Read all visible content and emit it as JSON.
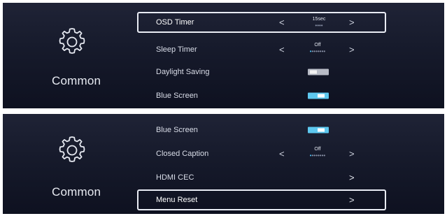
{
  "panels": [
    {
      "category": {
        "label": "Common",
        "icon": "gear-icon"
      },
      "rows": [
        {
          "label": "OSD Timer",
          "type": "selector",
          "value": "15sec",
          "selected": true,
          "dots_total": 4,
          "dots_active": 0
        },
        {
          "label": "Sleep Timer",
          "type": "selector",
          "value": "Off",
          "selected": false,
          "dots_total": 8,
          "dots_active": 1
        },
        {
          "label": "Daylight Saving",
          "type": "toggle",
          "state": "off",
          "selected": false
        },
        {
          "label": "Blue Screen",
          "type": "toggle",
          "state": "on",
          "selected": false
        }
      ]
    },
    {
      "category": {
        "label": "Common",
        "icon": "gear-icon"
      },
      "rows": [
        {
          "label": "Blue Screen",
          "type": "toggle",
          "state": "on",
          "selected": false
        },
        {
          "label": "Closed Caption",
          "type": "selector",
          "value": "Off",
          "selected": false,
          "dots_total": 8,
          "dots_active": 1
        },
        {
          "label": "HDMI CEC",
          "type": "submenu",
          "selected": false
        },
        {
          "label": "Menu Reset",
          "type": "submenu",
          "selected": true
        }
      ]
    }
  ],
  "glyphs": {
    "left_arrow": "<",
    "right_arrow": ">",
    "chevron": ">"
  },
  "colors": {
    "panel_bg": "#161a2b",
    "accent_on": "#5ec8ef",
    "toggle_off": "#b8bcc6",
    "highlight_border": "#e9ecf4",
    "text": "#d9dde8"
  }
}
